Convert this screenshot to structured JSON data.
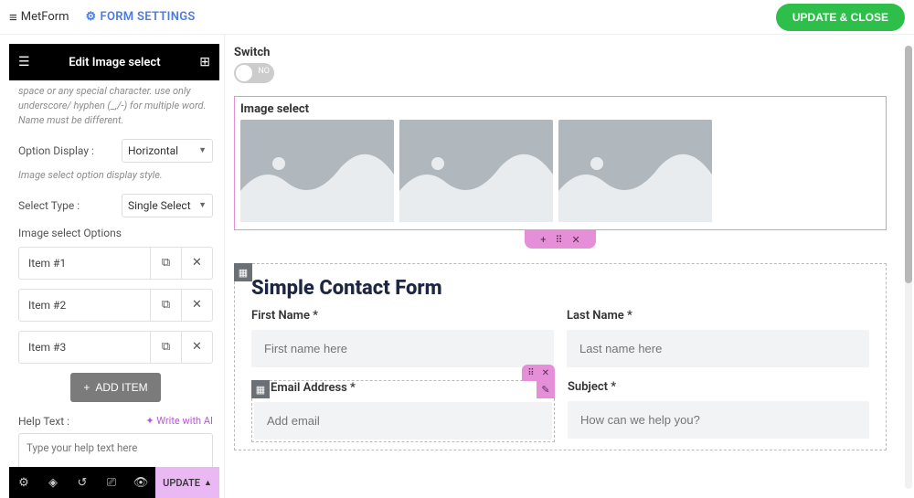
{
  "topbar": {
    "brand": "MetForm",
    "form_settings": "FORM SETTINGS",
    "update_close": "UPDATE & CLOSE"
  },
  "panel": {
    "title": "Edit Image select",
    "name_help": "space or any special character. use only underscore/ hyphen (_,/-) for multiple word. Name must be different.",
    "option_display_label": "Option Display :",
    "option_display_value": "Horizontal",
    "option_display_help": "Image select option display style.",
    "select_type_label": "Select Type :",
    "select_type_value": "Single Select",
    "options_label": "Image select Options",
    "items": [
      {
        "label": "Item #1"
      },
      {
        "label": "Item #2"
      },
      {
        "label": "Item #3"
      }
    ],
    "add_item": "ADD ITEM",
    "help_text_label": "Help Text :",
    "write_ai": "✦ Write with AI",
    "help_placeholder": "Type your help text here"
  },
  "bottombar": {
    "update": "UPDATE"
  },
  "canvas": {
    "switch_label": "Switch",
    "switch_off": "NO",
    "image_select_title": "Image select",
    "section_title": "Simple Contact Form",
    "first_name_label": "First Name *",
    "first_name_ph": "First name here",
    "last_name_label": "Last Name *",
    "last_name_ph": "Last name here",
    "email_label": "Email Address *",
    "email_ph": "Add email",
    "subject_label": "Subject *",
    "subject_ph": "How can we help you?"
  }
}
